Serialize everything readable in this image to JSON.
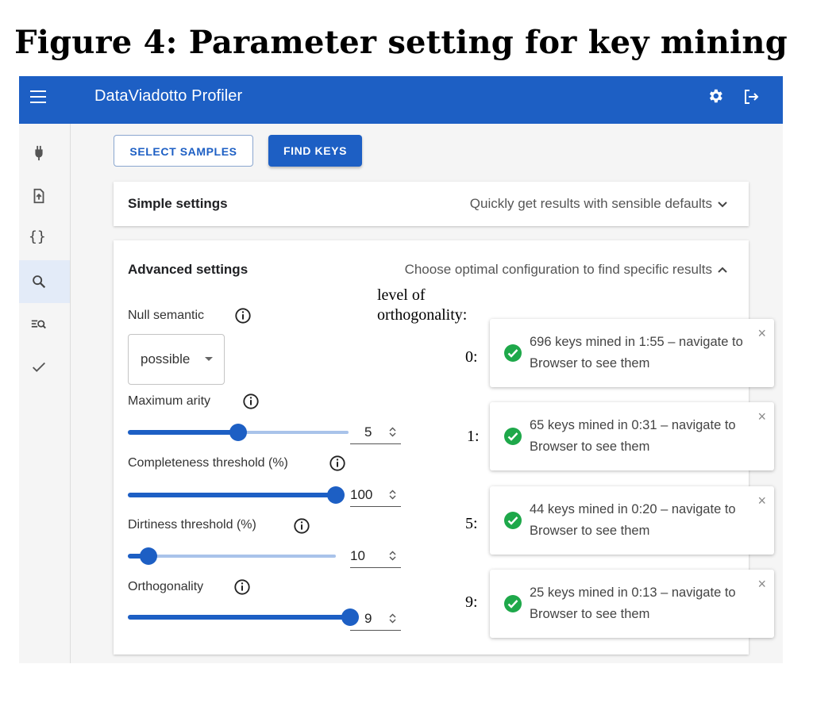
{
  "figure": {
    "title": "Figure 4: Parameter setting for key mining"
  },
  "app": {
    "title": "DataViadotto Profiler",
    "icons": {
      "menu": "menu-icon",
      "settings": "gear-icon",
      "logout": "logout-icon"
    },
    "colors": {
      "primary": "#1d5fc4",
      "success": "#1ea84a"
    }
  },
  "sidebar": {
    "items": [
      {
        "icon": "plug-icon",
        "glyph": ""
      },
      {
        "icon": "file-upload-icon",
        "glyph": ""
      },
      {
        "icon": "curly-braces-icon",
        "glyph": "{}"
      },
      {
        "icon": "search-icon",
        "glyph": "",
        "active": true
      },
      {
        "icon": "list-search-icon",
        "glyph": ""
      },
      {
        "icon": "check-icon",
        "glyph": ""
      }
    ]
  },
  "toolbar": {
    "select_samples_label": "SELECT SAMPLES",
    "find_keys_label": "FIND KEYS"
  },
  "simple": {
    "title": "Simple settings",
    "description": "Quickly get results with sensible defaults"
  },
  "advanced": {
    "title": "Advanced settings",
    "description": "Choose optimal configuration to find specific results",
    "null_semantic": {
      "label": "Null semantic",
      "value": "possible"
    },
    "max_arity": {
      "label": "Maximum arity",
      "value": "5",
      "level": 0.5
    },
    "completeness": {
      "label": "Completeness threshold (%)",
      "value": "100",
      "level": 1.0
    },
    "dirtiness": {
      "label": "Dirtiness threshold (%)",
      "value": "10",
      "level": 0.1
    },
    "orthogonality": {
      "label": "Orthogonality",
      "value": "9",
      "level": 1.0
    }
  },
  "annotation": {
    "heading_line1": "level of",
    "heading_line2": "orthogonality:",
    "levels": [
      "0:",
      "1:",
      "5:",
      "9:"
    ]
  },
  "notifications": [
    {
      "message": "696 keys mined in 1:55 – navigate to Browser to see them",
      "close": "×"
    },
    {
      "message": "65 keys mined in 0:31 – navigate to Browser to see them",
      "close": "×"
    },
    {
      "message": "44 keys mined in 0:20 – navigate to Browser to see them",
      "close": "×"
    },
    {
      "message": "25 keys mined in 0:13 – navigate to Browser to see them",
      "close": "×"
    }
  ]
}
